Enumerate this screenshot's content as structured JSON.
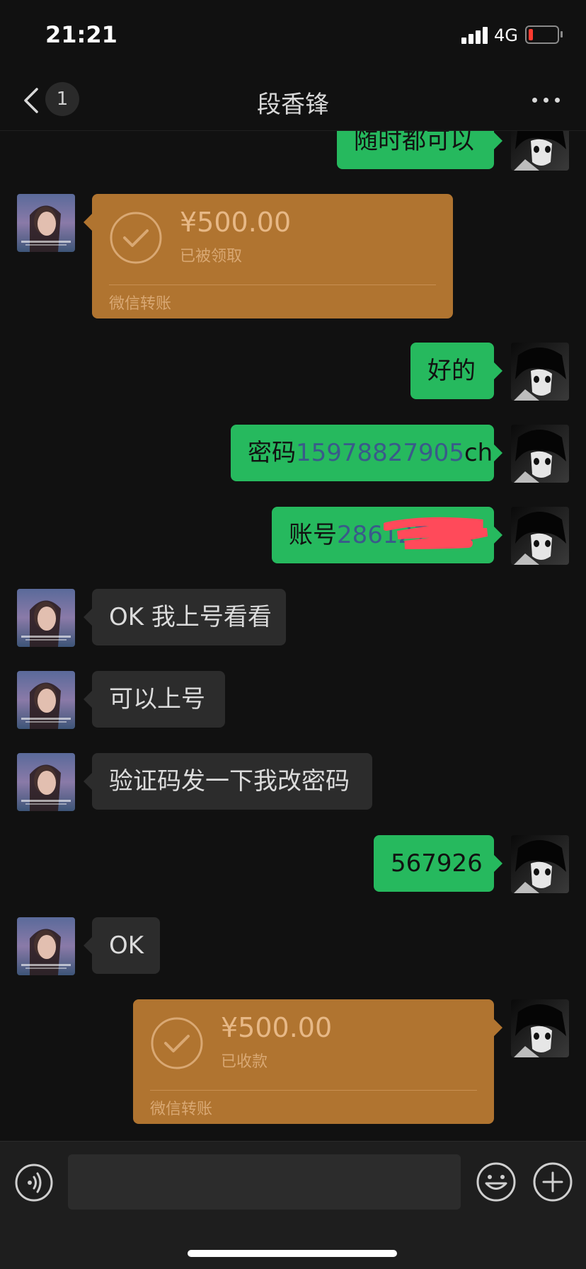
{
  "status_bar": {
    "time": "21:21",
    "network": "4G",
    "battery_color": "#ff3b30"
  },
  "header": {
    "unread_count": "1",
    "title": "段香锋",
    "back_icon": "chevron-left-icon",
    "more_icon": "more-dots-icon"
  },
  "colors": {
    "outgoing_bubble": "#26b95e",
    "incoming_bubble": "#2c2c2c",
    "transfer_card": "#b07430",
    "link_text": "#3a5a8a"
  },
  "messages": [
    {
      "side": "out",
      "text": "随时都可以"
    },
    {
      "side": "in",
      "type": "transfer",
      "amount": "¥500.00",
      "status": "已被领取",
      "label": "微信转账"
    },
    {
      "side": "out",
      "text": "好的"
    },
    {
      "side": "out",
      "prefix": "密码",
      "highlight": "15978827905",
      "suffix": "ch"
    },
    {
      "side": "out",
      "prefix": "账号",
      "highlight": "28612",
      "redacted": true
    },
    {
      "side": "in",
      "text": "OK 我上号看看"
    },
    {
      "side": "in",
      "text": "可以上号"
    },
    {
      "side": "in",
      "text": "验证码发一下我改密码"
    },
    {
      "side": "out",
      "text": "567926"
    },
    {
      "side": "in",
      "text": "OK"
    },
    {
      "side": "out",
      "type": "transfer",
      "amount": "¥500.00",
      "status": "已收款",
      "label": "微信转账"
    }
  ],
  "input_bar": {
    "voice_icon": "voice-icon",
    "emoji_icon": "emoji-icon",
    "plus_icon": "plus-icon",
    "value": ""
  }
}
